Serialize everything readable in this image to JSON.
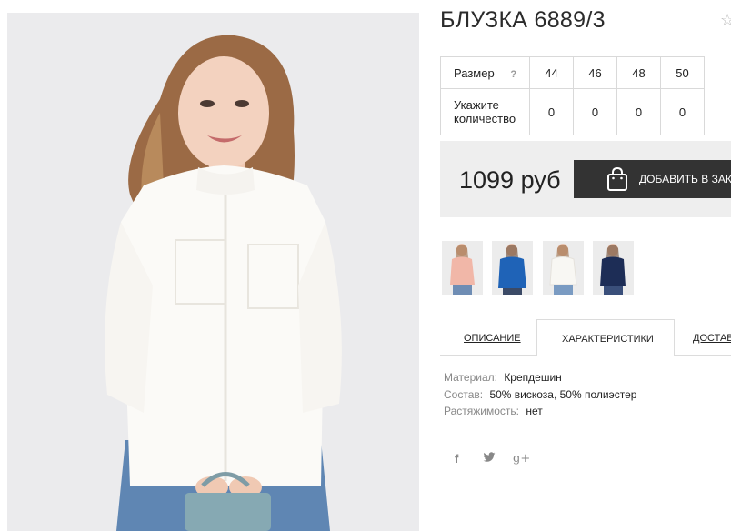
{
  "product": {
    "title": "БЛУЗКА 6889/3",
    "favorite_icon": "star-outline-icon"
  },
  "sizes_table": {
    "size_label": "Размер",
    "help_mark": "?",
    "sizes": [
      "44",
      "46",
      "48",
      "50"
    ],
    "quantity_label_line1": "Укажите",
    "quantity_label_line2": "количество",
    "quantities": [
      "0",
      "0",
      "0",
      "0"
    ]
  },
  "buy": {
    "price": "1099 руб",
    "add_to_cart_label": "ДОБАВИТЬ В ЗАКАЗ",
    "bag_icon": "shopping-bag-icon"
  },
  "thumbnails": [
    {
      "color": "#f1b7a8",
      "label": "pink"
    },
    {
      "color": "#1f63b7",
      "label": "blue"
    },
    {
      "color": "#f4f2ee",
      "label": "white"
    },
    {
      "color": "#1d2d56",
      "label": "navy"
    }
  ],
  "tabs": [
    {
      "label": "ОПИСАНИЕ",
      "active": false
    },
    {
      "label": "ХАРАКТЕРИСТИКИ",
      "active": true
    },
    {
      "label": "ДОСТАВКА",
      "active": false
    }
  ],
  "specs": [
    {
      "key": "Материал:",
      "value": "Крепдешин"
    },
    {
      "key": "Состав:",
      "value": "50% вискоза, 50% полиэстер"
    },
    {
      "key": "Растяжимость:",
      "value": "нет"
    }
  ],
  "social": [
    {
      "icon": "facebook-icon",
      "glyph": "f"
    },
    {
      "icon": "twitter-icon",
      "glyph": "🐦"
    },
    {
      "icon": "google-plus-icon",
      "glyph": "g+"
    }
  ],
  "colors": {
    "button_bg": "#333333",
    "buybox_bg": "#eeeeee",
    "border": "#d9d9d9"
  }
}
